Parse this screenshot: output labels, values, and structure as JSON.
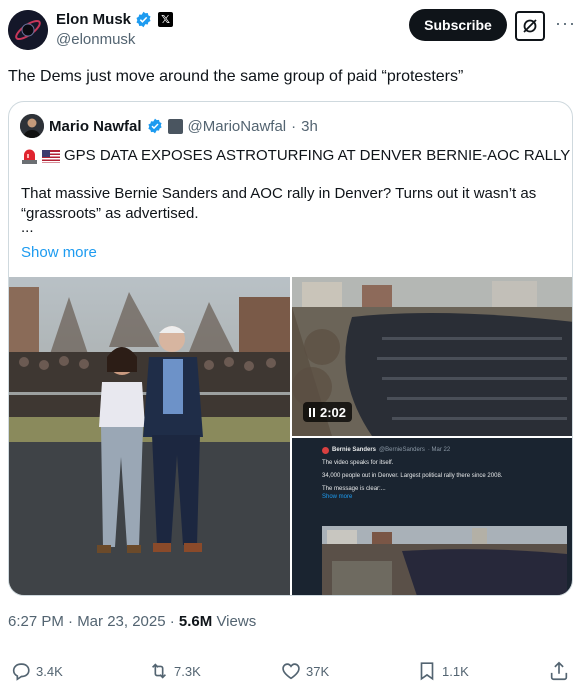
{
  "author": {
    "name": "Elon Musk",
    "handle": "@elonmusk"
  },
  "header": {
    "subscribe_label": "Subscribe",
    "more_label": "···"
  },
  "tweet": {
    "text": "The Dems just move around the same group of paid “protesters”"
  },
  "quote": {
    "name": "Mario Nawfal",
    "handle": "@MarioNawfal",
    "separator": "·",
    "time": "3h",
    "headline": "GPS DATA EXPOSES ASTROTURFING AT DENVER BERNIE-AOC RALLY",
    "paragraph": "That massive Bernie Sanders and AOC rally in Denver? Turns out it wasn’t as “grassroots” as advertised.",
    "ellipsis": "...",
    "show_more": "Show more",
    "video_duration": "2:02",
    "inner_post": {
      "name": "Bernie Sanders",
      "handle": "@BernieSanders",
      "date": "· Mar 22",
      "line1": "The video speaks for itself.",
      "line2": "34,000 people out in Denver. Largest political rally there since 2008.",
      "line3": "The message is clear:...",
      "show_more": "Show more"
    }
  },
  "meta": {
    "time": "6:27 PM · Mar 23, 2025 · ",
    "views_count": "5.6M",
    "views_label": " Views"
  },
  "actions": {
    "replies": "3.4K",
    "reposts": "7.3K",
    "likes": "37K",
    "bookmarks": "1.1K"
  },
  "colors": {
    "accent": "#1d9bf0",
    "text": "#0f1419",
    "secondary": "#536471",
    "border": "#cfd9de"
  }
}
